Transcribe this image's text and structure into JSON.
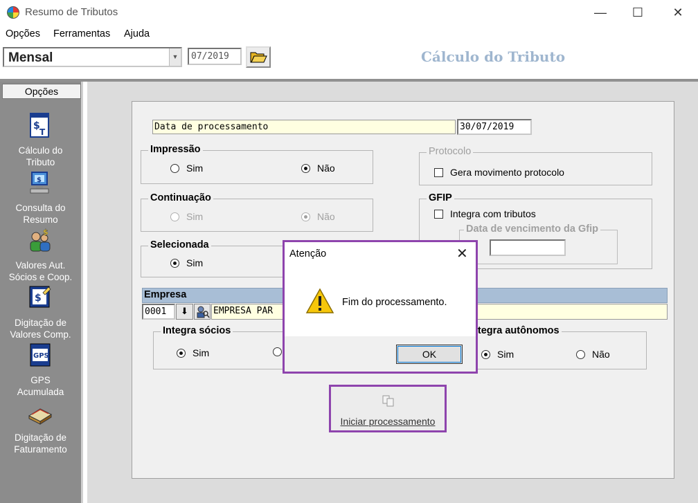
{
  "window": {
    "title": "Resumo de Tributos",
    "minimize": "—",
    "maximize": "☐",
    "close": "✕"
  },
  "menu": {
    "items": [
      "Opções",
      "Ferramentas",
      "Ajuda"
    ]
  },
  "toolbar": {
    "period": "Mensal",
    "month": "07/2019",
    "page_title": "Cálculo do Tributo"
  },
  "sidebar": {
    "header": "Opções",
    "items": [
      {
        "label_line1": "Cálculo do",
        "label_line2": "Tributo",
        "icon": "tax-calculation-icon"
      },
      {
        "label_line1": "Consulta do",
        "label_line2": "Resumo",
        "icon": "computer-query-icon"
      },
      {
        "label_line1": "Valores Aut.",
        "label_line2": "Sócios e  Coop.",
        "icon": "people-money-icon"
      },
      {
        "label_line1": "Digitação de",
        "label_line2": "Valores Comp.",
        "icon": "document-entry-icon"
      },
      {
        "label_line1": "GPS",
        "label_line2": "Acumulada",
        "icon": "gps-icon"
      },
      {
        "label_line1": "Digitação de",
        "label_line2": "Faturamento",
        "icon": "notebook-icon"
      }
    ]
  },
  "form": {
    "process_date_label": "Data de processamento",
    "process_date_value": "30/07/2019",
    "impressao": {
      "title": "Impressão",
      "sim": "Sim",
      "nao": "Não",
      "selected": "nao"
    },
    "continuacao": {
      "title": "Continuação",
      "sim": "Sim",
      "nao": "Não",
      "selected": "nao"
    },
    "selecionada": {
      "title": "Selecionada",
      "sim": "Sim",
      "selected": "sim"
    },
    "protocolo": {
      "title": "Protocolo",
      "check_label": "Gera movimento protocolo"
    },
    "gfip": {
      "title": "GFIP",
      "check_label": "Integra com tributos",
      "due_date_title": "Data de vencimento da Gfip",
      "due_date_value": ""
    },
    "empresa": {
      "title": "Empresa",
      "code": "0001",
      "name": "EMPRESA PAR"
    },
    "integra_socios": {
      "title": "Integra sócios",
      "sim": "Sim"
    },
    "integra_autonomos": {
      "title": "Integra autônomos",
      "sim": "Sim",
      "nao": "Não",
      "selected": "sim"
    },
    "start_button": "Iniciar processamento"
  },
  "dialog": {
    "title": "Atenção",
    "message": "Fim do processamento.",
    "ok": "OK"
  },
  "colors": {
    "highlight_border": "#8e44ad",
    "sidebar_bg": "#8c8c8c",
    "heading": "#9fb6cf",
    "empresa_bar": "#a8bed6",
    "field_yellow": "#ffffe1"
  }
}
